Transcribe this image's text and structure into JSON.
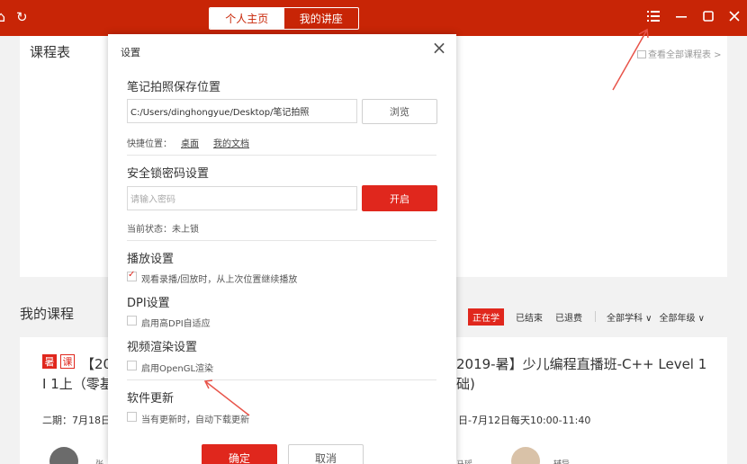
{
  "topbar": {
    "tabs": [
      "个人主页",
      "我的讲座"
    ],
    "active_tab_index": 0,
    "left_icons": [
      "home-icon",
      "refresh-icon"
    ],
    "right_icons": [
      "menu-icon",
      "minimize-icon",
      "maximize-icon",
      "close-icon"
    ],
    "bg_color": "#c82506"
  },
  "background": {
    "schedule_title": "课程表",
    "view_all_link": "查看全部课程表 >",
    "my_courses_title": "我的课程",
    "filters": {
      "active": "正在学",
      "options": [
        "已结束",
        "已退费"
      ],
      "dropdowns": [
        "全部学科 ∨",
        "全部年级 ∨"
      ]
    },
    "course": {
      "tags": [
        "暑",
        "课"
      ],
      "title_left_line1": "【20",
      "title_left_line2": "I 1上（零基",
      "title_right_line1": "2019-暑】少儿编程直播班-C++ Level 1",
      "title_right_line2": "础)",
      "schedule_left": "二期：7月18日",
      "schedule_right": "日-7月12日每天10:00-11:40",
      "teacher_names": [
        "张",
        "马瑶",
        "辅导"
      ]
    }
  },
  "dialog": {
    "title": "设置",
    "note_save": {
      "heading": "笔记拍照保存位置",
      "path_value": "C:/Users/dinghongyue/Desktop/笔记拍照",
      "browse_label": "浏览",
      "quick_label": "快捷位置：",
      "quick_links": [
        "桌面",
        "我的文档"
      ]
    },
    "security": {
      "heading": "安全锁密码设置",
      "password_placeholder": "请输入密码",
      "enable_label": "开启",
      "status": "当前状态：未上锁"
    },
    "playback": {
      "heading": "播放设置",
      "option": "观看录播/回放时，从上次位置继续播放",
      "checked": true
    },
    "dpi": {
      "heading": "DPI设置",
      "option": "启用高DPI自适应",
      "checked": false
    },
    "render": {
      "heading": "视频渲染设置",
      "option": "启用OpenGL渲染",
      "checked": false
    },
    "update": {
      "heading": "软件更新",
      "option": "当有更新时，自动下载更新",
      "checked": false
    },
    "confirm_label": "确定",
    "cancel_label": "取消"
  },
  "colors": {
    "accent_red": "#e0271d",
    "annotation_arrow": "#e8544a"
  }
}
